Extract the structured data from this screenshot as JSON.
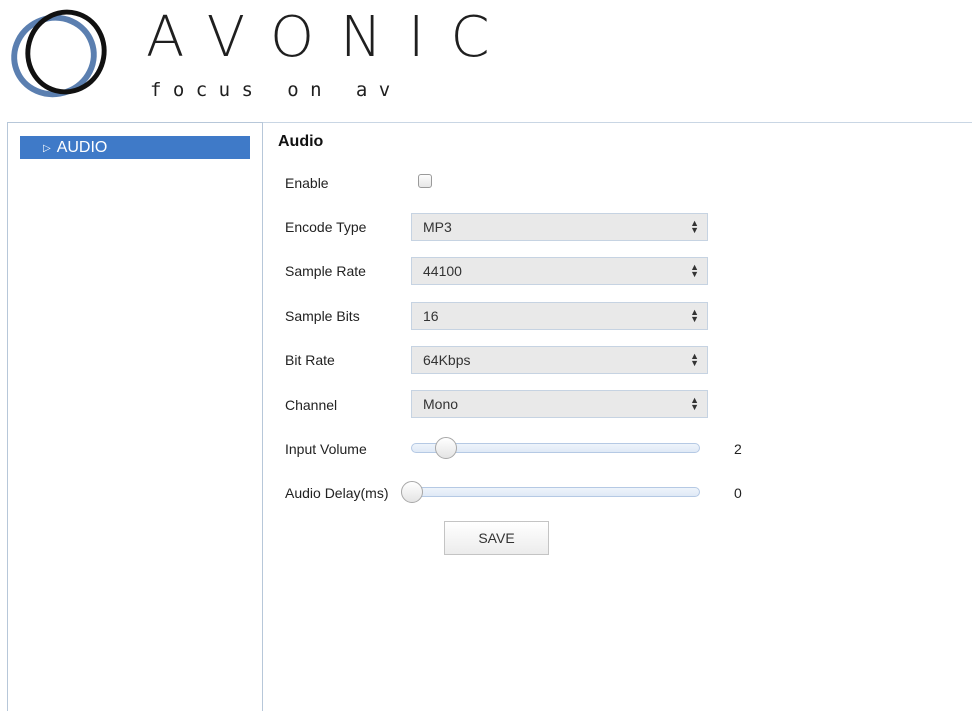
{
  "brand": {
    "name": "AVONIC",
    "tagline": "f o c u s   o n   a v"
  },
  "sidebar": {
    "items": [
      {
        "label": "AUDIO",
        "active": true,
        "icon": "triangle-right-icon"
      }
    ]
  },
  "audio": {
    "title": "Audio",
    "enable": {
      "label": "Enable",
      "checked": false
    },
    "encode_type": {
      "label": "Encode Type",
      "value": "MP3"
    },
    "sample_rate": {
      "label": "Sample Rate",
      "value": "44100"
    },
    "sample_bits": {
      "label": "Sample Bits",
      "value": "16"
    },
    "bit_rate": {
      "label": "Bit Rate",
      "value": "64Kbps"
    },
    "channel": {
      "label": "Channel",
      "value": "Mono"
    },
    "input_volume": {
      "label": "Input Volume",
      "value": "2"
    },
    "audio_delay": {
      "label": "Audio Delay(ms)",
      "value": "0"
    },
    "save_label": "SAVE"
  },
  "colors": {
    "accent": "#3f7ac8",
    "border": "#b7c7d9"
  }
}
